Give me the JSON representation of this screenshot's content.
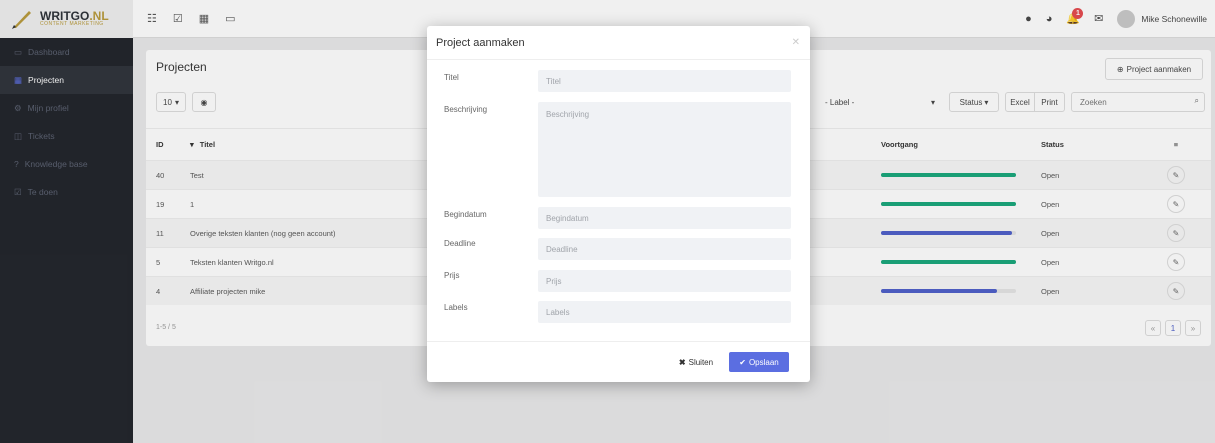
{
  "logo": {
    "title_main": "WRITGO",
    "title_ext": ".NL",
    "subtitle": "CONTENT MARKETING"
  },
  "topbar": {
    "notification_count": "1",
    "user_name": "Mike Schonewille"
  },
  "sidebar": {
    "items": [
      {
        "label": "Dashboard",
        "icon": "monitor-icon"
      },
      {
        "label": "Projecten",
        "icon": "grid-icon",
        "active": true
      },
      {
        "label": "Mijn profiel",
        "icon": "gear-icon"
      },
      {
        "label": "Tickets",
        "icon": "ticket-icon"
      },
      {
        "label": "Knowledge base",
        "icon": "question-icon"
      },
      {
        "label": "Te doen",
        "icon": "check-icon"
      }
    ]
  },
  "main": {
    "title": "Projecten",
    "create_button": "Project aanmaken",
    "page_size": "10",
    "label_filter": "- Label -",
    "status_filter": "Status",
    "excel_button": "Excel",
    "print_button": "Print",
    "search_placeholder": "Zoeken",
    "columns": {
      "id": "ID",
      "title": "Titel",
      "progress": "Voortgang",
      "status": "Status"
    },
    "rows": [
      {
        "id": "40",
        "title": "Test",
        "progress": 1.0,
        "color": "#16a67a",
        "status": "Open"
      },
      {
        "id": "19",
        "title": "1",
        "progress": 1.0,
        "color": "#16a67a",
        "status": "Open"
      },
      {
        "id": "11",
        "title": "Overige teksten klanten (nog geen account)",
        "progress": 0.97,
        "color": "#4c5ec9",
        "status": "Open"
      },
      {
        "id": "5",
        "title": "Teksten klanten Writgo.nl",
        "progress": 1.0,
        "color": "#16a67a",
        "status": "Open"
      },
      {
        "id": "4",
        "title": "Affiliate projecten mike",
        "progress": 0.86,
        "color": "#4c5ec9",
        "status": "Open"
      }
    ],
    "count_text": "1-5 / 5",
    "page_current": "1"
  },
  "modal": {
    "title": "Project aanmaken",
    "fields": {
      "titel": {
        "label": "Titel",
        "placeholder": "Titel"
      },
      "beschrijving": {
        "label": "Beschrijving",
        "placeholder": "Beschrijving"
      },
      "begindatum": {
        "label": "Begindatum",
        "placeholder": "Begindatum"
      },
      "deadline": {
        "label": "Deadline",
        "placeholder": "Deadline"
      },
      "prijs": {
        "label": "Prijs",
        "placeholder": "Prijs"
      },
      "labels": {
        "label": "Labels",
        "placeholder": "Labels"
      }
    },
    "close_button": "Sluiten",
    "save_button": "Opslaan",
    "accent": "#5b6ee1"
  }
}
